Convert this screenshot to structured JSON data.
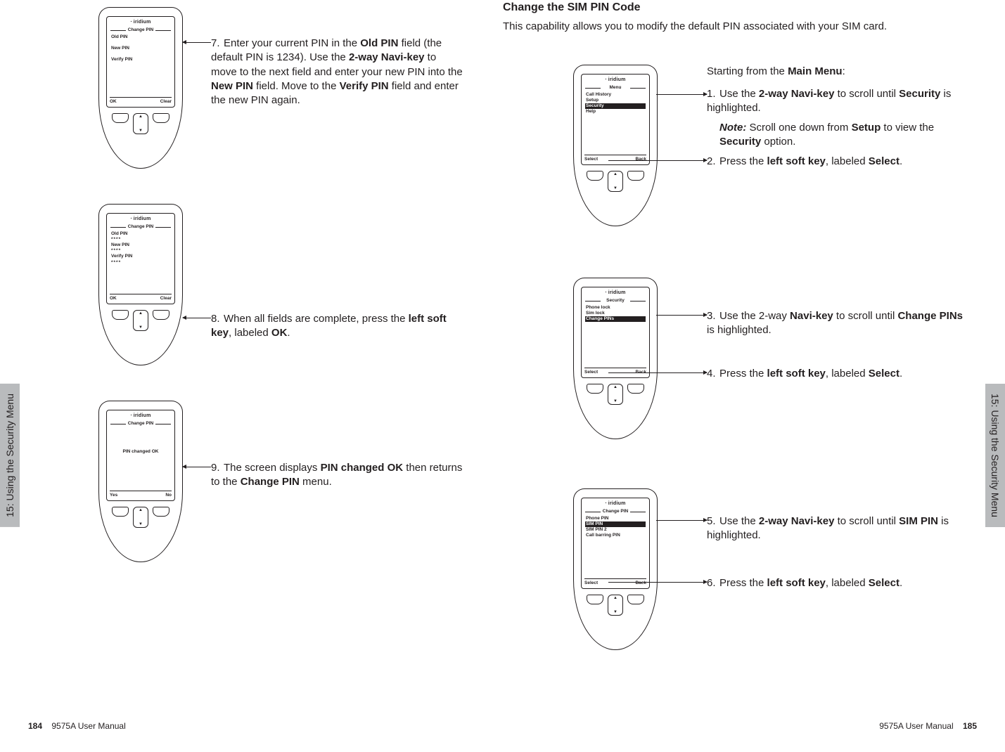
{
  "doc": {
    "title": "9575A User Manual",
    "section": "15: Using the Security Menu",
    "page_left": "184",
    "page_right": "185"
  },
  "brand": "iridium",
  "left": {
    "p7": {
      "screen_title": "Change PIN",
      "fields": {
        "old": "Old PIN",
        "new": "New PIN",
        "verify": "Verify PIN"
      },
      "softL": "OK",
      "softR": "Clear",
      "text_a": "Enter your current PIN in the ",
      "text_b": " field (the default PIN is 1234). Use the ",
      "text_c": " to move to the next field and enter your new PIN into the ",
      "text_d": " field. Move to the ",
      "text_e": " field and enter the new PIN again.",
      "bold1": "Old PIN",
      "bold2": "2-way Navi-key",
      "bold3": "New PIN",
      "bold4": "Verify PIN"
    },
    "p8": {
      "screen_title": "Change PIN",
      "fields": {
        "old": "Old PIN",
        "new": "New PIN",
        "verify": "Verify PIN",
        "mask": "****"
      },
      "softL": "OK",
      "softR": "Clear",
      "text_a": "When all fields are complete, press the ",
      "bold1": "left soft key",
      "text_b": ", labeled ",
      "bold2": "OK",
      "text_c": "."
    },
    "p9": {
      "screen_title": "Change PIN",
      "msg": "PIN changed OK",
      "softL": "Yes",
      "softR": "No",
      "text_a": "The screen displays ",
      "bold1": "PIN changed OK",
      "text_b": " then returns to the ",
      "bold2": "Change PIN",
      "text_c": " menu."
    }
  },
  "right": {
    "heading": "Change the SIM PIN Code",
    "intro": "This capability allows you to modify the default PIN associated with your SIM card.",
    "starting": "Starting from the ",
    "starting_bold": "Main Menu",
    "starting_end": ":",
    "r1": {
      "screen_title": "Menu",
      "items": [
        "Call History",
        "Setup",
        "Security",
        "Help"
      ],
      "sel_index": 2,
      "softL": "Select",
      "softR": "Back",
      "step1a": "Use the ",
      "step1b": "2-way Navi-key",
      "step1c": " to scroll until ",
      "step1d": "Security",
      "step1e": " is highlighted.",
      "note_l": "Note:",
      "note_a": " Scroll one down from ",
      "note_b": "Setup",
      "note_c": " to view the ",
      "note_d": "Security",
      "note_e": " option.",
      "step2a": "Press the ",
      "step2b": "left soft key",
      "step2c": ", labeled ",
      "step2d": "Select",
      "step2e": "."
    },
    "r2": {
      "screen_title": "Security",
      "items": [
        "Phone lock",
        "Sim lock",
        "Change PINs"
      ],
      "sel_index": 2,
      "softL": "Select",
      "softR": "Back",
      "step3a": "Use the 2-way ",
      "step3b": "Navi-key",
      "step3c": " to scroll until ",
      "step3d": "Change PINs",
      "step3e": " is highlighted.",
      "step4a": "Press the ",
      "step4b": "left soft key",
      "step4c": ", labeled ",
      "step4d": "Select",
      "step4e": "."
    },
    "r3": {
      "screen_title": "Change PIN",
      "items": [
        "Phone PIN",
        "SIM PIN",
        "SIM PIN 2",
        "Call barring PIN"
      ],
      "sel_index": 1,
      "softL": "Select",
      "softR": "Back",
      "step5a": "Use the ",
      "step5b": "2-way Navi-key",
      "step5c": " to scroll until ",
      "step5d": "SIM PIN",
      "step5e": " is highlighted.",
      "step6a": "Press the ",
      "step6b": "left soft key",
      "step6c": ", labeled ",
      "step6d": "Select",
      "step6e": "."
    }
  }
}
